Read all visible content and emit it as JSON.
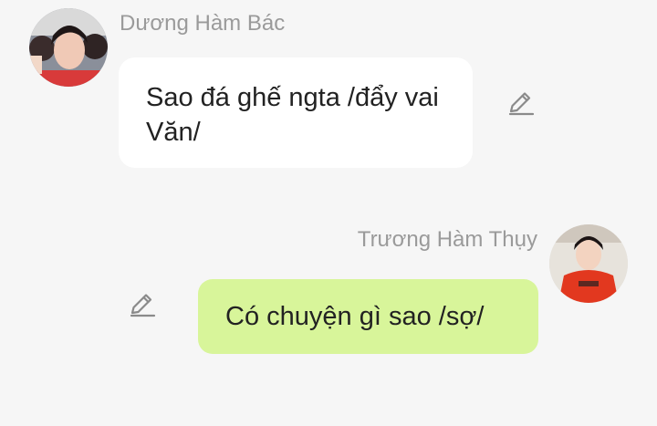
{
  "messages": [
    {
      "sender": "Dương Hàm Bác",
      "text": "Sao đá ghế ngta /đẩy vai Văn/",
      "side": "left",
      "bubble_color": "#ffffff",
      "edit_icon": "pencil-icon"
    },
    {
      "sender": "Trương Hàm Thụy",
      "text": "Có chuyện gì sao /sợ/",
      "side": "right",
      "bubble_color": "#d8f59a",
      "edit_icon": "pencil-icon"
    }
  ]
}
